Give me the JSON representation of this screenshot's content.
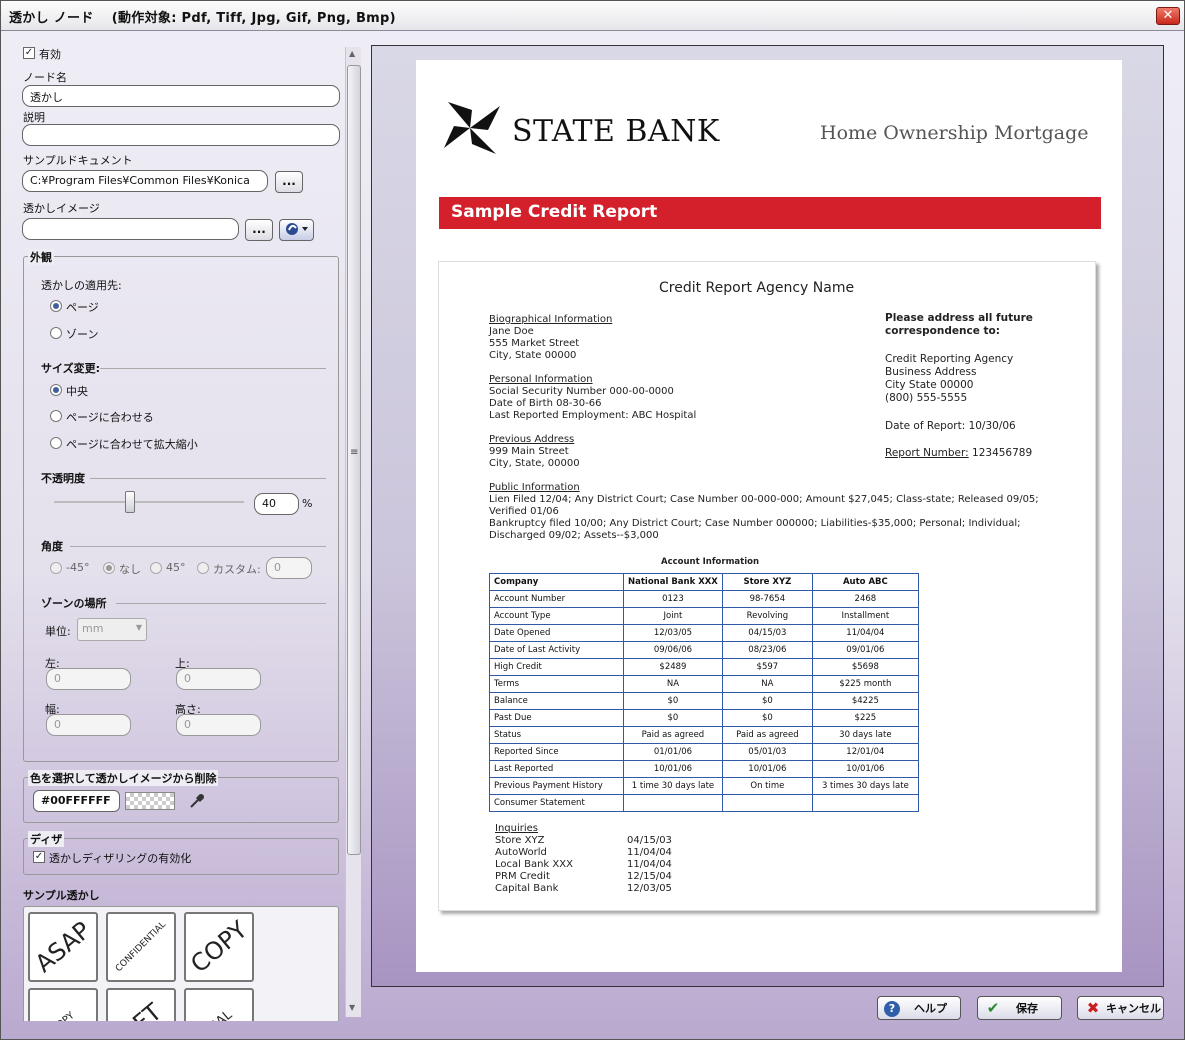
{
  "window": {
    "title": "透かし ノード　 (動作対象: Pdf, Tiff, Jpg, Gif, Png, Bmp)",
    "close_label": "✕"
  },
  "settings": {
    "enabled_label": "有効",
    "node_name_label": "ノード名",
    "node_name_value": "透かし",
    "description_label": "説明",
    "description_value": "",
    "sample_doc_label": "サンプルドキュメント",
    "sample_doc_value": "C:¥Program Files¥Common Files¥Konica",
    "watermark_image_label": "透かしイメージ",
    "watermark_image_value": "",
    "browse_label": "...",
    "appearance": {
      "title": "外観",
      "apply_to_label": "透かしの適用先:",
      "apply_page": "ページ",
      "apply_zone": "ゾーン",
      "resize_label": "サイズ変更:",
      "resize_center": "中央",
      "resize_fit": "ページに合わせる",
      "resize_fit_scale": "ページに合わせて拡大縮小",
      "opacity_label": "不透明度",
      "opacity_value": "40",
      "opacity_unit": "%",
      "opacity_fraction": 0.4,
      "angle_label": "角度",
      "angle_minus45": "-45°",
      "angle_none": "なし",
      "angle_45": "45°",
      "angle_custom": "カスタム:",
      "angle_custom_value": "0",
      "zone_location_label": "ゾーンの場所",
      "unit_label": "単位:",
      "unit_value": "mm",
      "left_label": "左:",
      "left_value": "0",
      "top_label": "上:",
      "top_value": "0",
      "width_label": "幅:",
      "width_value": "0",
      "height_label": "高さ:",
      "height_value": "0"
    },
    "color_remove": {
      "title": "色を選択して透かしイメージから削除",
      "color_value": "#00FFFFFF"
    },
    "dither": {
      "title": "ディザ",
      "enable_label": "透かしディザリングの有効化"
    },
    "samples": {
      "title": "サンプル透かし",
      "items": [
        "ASAP",
        "CONFIDENTIAL",
        "COPY",
        "COPY",
        "AFT",
        "INAL"
      ]
    }
  },
  "preview": {
    "bank_name": "STATE BANK",
    "tagline": "Home Ownership Mortgage",
    "banner": "Sample Credit Report",
    "agency": "Credit Report Agency Name",
    "bio_heading": "Biographical Information",
    "bio_lines": [
      "Jane Doe",
      "555 Market Street",
      "City, State 00000"
    ],
    "personal_heading": "Personal Information",
    "personal_lines": [
      "Social Security Number 000-00-0000",
      "Date of Birth 08-30-66",
      "Last Reported Employment: ABC Hospital"
    ],
    "prev_heading": "Previous Address",
    "prev_lines": [
      "999 Main Street",
      "City, State, 00000"
    ],
    "public_heading": "Public Information",
    "public_lines": [
      "Lien Filed 12/04; Any District Court; Case Number 00-000-000; Amount $27,045; Class-state; Released 09/05;",
      "Verified 01/06",
      "Bankruptcy filed 10/00; Any District Court; Case Number 000000; Liabilities-$35,000; Personal; Individual;",
      "Discharged 09/02; Assets--$3,000"
    ],
    "address_heading1": "Please address all future",
    "address_heading2": "correspondence to:",
    "address_lines": [
      "Credit Reporting Agency",
      "Business Address",
      "City State 00000",
      "(800) 555-5555"
    ],
    "date_of_report": "Date of Report: 10/30/06",
    "report_number_label": "Report Number:",
    "report_number_value": "123456789",
    "account_title": "Account Information",
    "account_table": [
      [
        "Company",
        "National Bank XXX",
        "Store XYZ",
        "Auto ABC"
      ],
      [
        "Account Number",
        "0123",
        "98-7654",
        "2468"
      ],
      [
        "Account Type",
        "Joint",
        "Revolving",
        "Installment"
      ],
      [
        "Date Opened",
        "12/03/05",
        "04/15/03",
        "11/04/04"
      ],
      [
        "Date of Last Activity",
        "09/06/06",
        "08/23/06",
        "09/01/06"
      ],
      [
        "High Credit",
        "$2489",
        "$597",
        "$5698"
      ],
      [
        "Terms",
        "NA",
        "NA",
        "$225 month"
      ],
      [
        "Balance",
        "$0",
        "$0",
        "$4225"
      ],
      [
        "Past Due",
        "$0",
        "$0",
        "$225"
      ],
      [
        "Status",
        "Paid as agreed",
        "Paid as agreed",
        "30 days late"
      ],
      [
        "Reported Since",
        "01/01/06",
        "05/01/03",
        "12/01/04"
      ],
      [
        "Last Reported",
        "10/01/06",
        "10/01/06",
        "10/01/06"
      ],
      [
        "Previous Payment History",
        "1 time 30 days late",
        "On time",
        "3 times 30 days late"
      ],
      [
        "Consumer Statement",
        "",
        "",
        ""
      ]
    ],
    "inquiries_heading": "Inquiries",
    "inquiries": [
      [
        "Store XYZ",
        "04/15/03"
      ],
      [
        "AutoWorld",
        "11/04/04"
      ],
      [
        "Local Bank XXX",
        "11/04/04"
      ],
      [
        "PRM Credit",
        "12/15/04"
      ],
      [
        "Capital Bank",
        "12/03/05"
      ]
    ]
  },
  "buttons": {
    "help": "ヘルプ",
    "save": "保存",
    "cancel": "キャンセル"
  },
  "colors": {
    "banner_red": "#d4202a",
    "table_blue": "#2e5aa8"
  }
}
